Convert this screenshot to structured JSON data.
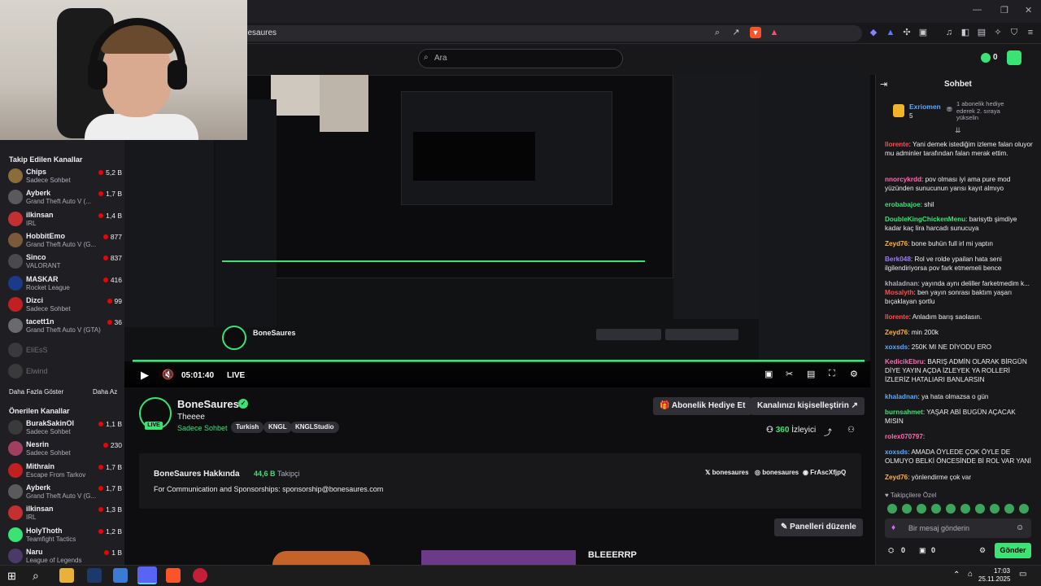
{
  "browser": {
    "url": "/bonesaures",
    "window_controls": [
      "—",
      "❐",
      "✕"
    ]
  },
  "header": {
    "search_placeholder": "Ara",
    "bits_count": "0"
  },
  "sidebar": {
    "followed_title": "Takip Edilen Kanallar",
    "followed": [
      {
        "name": "Chips",
        "game": "Sadece Sohbet",
        "viewers": "5,2 B",
        "color": "#8a6d3b"
      },
      {
        "name": "Ayberk",
        "game": "Grand Theft Auto V (...",
        "viewers": "1,7 B",
        "color": "#5a5a5a"
      },
      {
        "name": "ilkinsan",
        "game": "IRL",
        "viewers": "1,4 B",
        "color": "#c43030"
      },
      {
        "name": "HobbitEmo",
        "game": "Grand Theft Auto V (G...",
        "viewers": "877",
        "color": "#7a5a3a"
      },
      {
        "name": "Sinco",
        "game": "VALORANT",
        "viewers": "837",
        "color": "#4a4a4a"
      },
      {
        "name": "MASKAR",
        "game": "Rocket League",
        "viewers": "416",
        "color": "#1a3a8a"
      },
      {
        "name": "Dizci",
        "game": "Sadece Sohbet",
        "viewers": "99",
        "color": "#c02020"
      },
      {
        "name": "tacett1n",
        "game": "Grand Theft Auto V (GTA)",
        "viewers": "36",
        "color": "#6a6a6a"
      }
    ],
    "offline": [
      {
        "name": "EliEsS"
      },
      {
        "name": "Elwind"
      }
    ],
    "show_more": "Daha Fazla Göster",
    "show_less": "Daha Az",
    "recommended_title": "Önerilen Kanallar",
    "recommended": [
      {
        "name": "BurakSakinOl",
        "game": "Sadece Sohbet",
        "viewers": "1,1 B",
        "color": "#3a3a3a"
      },
      {
        "name": "Nesrin",
        "game": "Sadece Sohbet",
        "viewers": "230",
        "color": "#a04060"
      },
      {
        "name": "Mithrain",
        "game": "Escape From Tarkov",
        "viewers": "1,7 B",
        "color": "#c02020"
      },
      {
        "name": "Ayberk",
        "game": "Grand Theft Auto V (G...",
        "viewers": "1,7 B",
        "color": "#5a5a5a"
      },
      {
        "name": "ilkinsan",
        "game": "IRL",
        "viewers": "1,3 B",
        "color": "#c43030"
      },
      {
        "name": "HolyThoth",
        "game": "Teamfight Tactics",
        "viewers": "1,2 B",
        "color": "#3ae374"
      },
      {
        "name": "Naru",
        "game": "League of Legends",
        "viewers": "1 B",
        "color": "#4a3a6a"
      }
    ]
  },
  "player": {
    "time": "05:01:40",
    "live_label": "LIVE"
  },
  "channel": {
    "name": "BoneSaures",
    "live_badge": "LIVE",
    "title": "Theeee",
    "category": "Sadece Sohbet",
    "tags": [
      "Turkish",
      "KNGL",
      "KNGLStudio"
    ],
    "gift_button": "Abonelik Hediye Et",
    "customize_button": "Kanalınızı kişiselleştirin",
    "viewers": "360",
    "viewers_label": "İzleyici",
    "about_title": "BoneSaures Hakkında",
    "followers": "44,6 B",
    "followers_label": "Takipçi",
    "about_text": "For Communication and Sponsorships: sponsorship@bonesaures.com",
    "socials": [
      "bonesaures",
      "bonesaures",
      "FrAscXfjpQ"
    ],
    "edit_panels": "Panelleri düzenle",
    "panel_text": "BLEEERRP"
  },
  "chat": {
    "title": "Sohbet",
    "top_gifter": "Exriomen",
    "top_gifter_count": "5",
    "gift_note": "1 abonelik hediye ederek 2. sıraya yükselin",
    "messages": [
      {
        "user": "llorente",
        "color": "#ff4b4b",
        "text": "Yani demek istediğim izleme falan oluyor mu adminler tarafından falan merak ettim."
      },
      {
        "user": "nnorcykrdd",
        "color": "#ff69b4",
        "text": "pov olması iyi ama pure mod yüzünden sunucunun yarısı kayıt almıyo"
      },
      {
        "user": "erobabajoe",
        "color": "#3ae374",
        "text": "shil"
      },
      {
        "user": "DoubleKingChickenMenu",
        "color": "#3ae374",
        "text": "barisytb şimdiye kadar kaç lira harcadı sunucuya"
      },
      {
        "user": "Zeyd76",
        "color": "#ffb347",
        "text": "bone buhün full irl mi yaptın"
      },
      {
        "user": "Berk048",
        "color": "#9b7bff",
        "text": "Rol ve rolde ypailan hata seni ilgilendiriyorsa pov fark etmemeli bence"
      },
      {
        "user": "khaladnan",
        "color": "#adadb8",
        "text": "yayında aynı deliller farketmedim k..."
      },
      {
        "user": "Mosalyth",
        "color": "#ff4b4b",
        "text": "ben yayın sonrası baktım yaşarı bıçaklayan şortlu"
      },
      {
        "user": "llorente",
        "color": "#ff4b4b",
        "text": "Anladım barış saolasın."
      },
      {
        "user": "Zeyd76",
        "color": "#ffb347",
        "text": "min 200k"
      },
      {
        "user": "xoxsds",
        "color": "#5aa9ff",
        "text": "250K MI NE DİYODU ERO"
      },
      {
        "user": "KedicikEbru",
        "color": "#ff69b4",
        "text": "BARIŞ ADMİN OLARAK BİRGÜN DİYE YAYIN AÇDA İZLEYEK YA ROLLERİ İZLERİZ HATALIARI BANLARSIN"
      },
      {
        "user": "khaladnan",
        "color": "#5aa9ff",
        "text": "ya hata olmazsa o gün"
      },
      {
        "user": "burnsahmet",
        "color": "#3ae374",
        "text": "YAŞAR ABİ BUGÜN AÇACAK MISIN"
      },
      {
        "user": "rolex070797",
        "color": "#ff69b4",
        "text": ""
      },
      {
        "user": "xoxsds",
        "color": "#5aa9ff",
        "text": "AMADA ÖYLEDE ÇOK ÖYLE DE OLMUYO BELKİ ÖNCESİNDE Bİ ROL VAR YANİ"
      },
      {
        "user": "Zeyd76",
        "color": "#ffb347",
        "text": "yönlendirme çok var"
      }
    ],
    "followers_only": "Takipçilere Özel",
    "input_placeholder": "Bir mesaj gönderin",
    "points": "0",
    "send_button": "Gönder"
  },
  "taskbar": {
    "time": "17:03",
    "date": "25.11.2025"
  }
}
